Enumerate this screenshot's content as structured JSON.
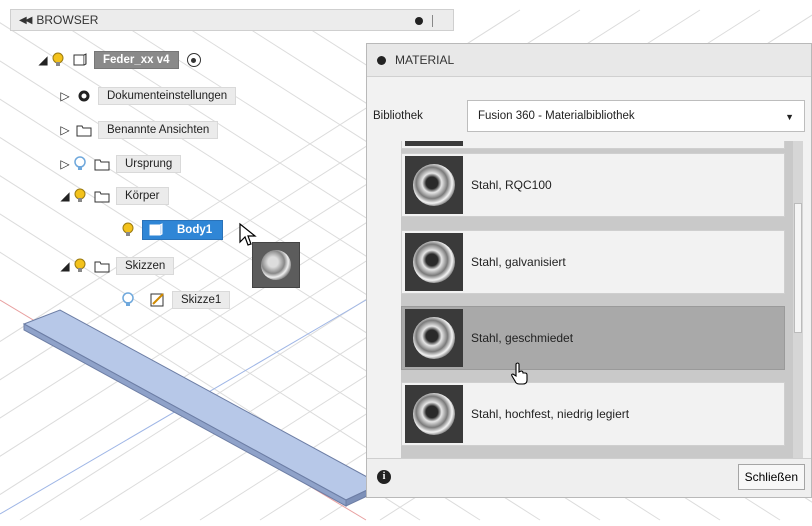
{
  "browser": {
    "title": "BROWSER",
    "root": {
      "label": "Feder_xx v4"
    },
    "items": [
      {
        "label": "Dokumenteinstellungen"
      },
      {
        "label": "Benannte Ansichten"
      },
      {
        "label": "Ursprung"
      },
      {
        "label": "Körper"
      },
      {
        "label": "Body1"
      },
      {
        "label": "Skizzen"
      },
      {
        "label": "Skizze1"
      }
    ]
  },
  "material": {
    "title": "MATERIAL",
    "library_label": "Bibliothek",
    "library_value": "Fusion 360 - Materialbibliothek",
    "items": [
      {
        "name": "Stahl, RQC100"
      },
      {
        "name": "Stahl, galvanisiert"
      },
      {
        "name": "Stahl, geschmiedet"
      },
      {
        "name": "Stahl, hochfest, niedrig legiert"
      }
    ],
    "close_label": "Schließen",
    "info_symbol": "i"
  },
  "colors": {
    "selection": "#2f86d6",
    "hover_row": "#a9a9a9",
    "bulb_yellow": "#f3c21b",
    "bulb_blue": "#6fa8dc",
    "body_plate": "#b7c8e8"
  }
}
